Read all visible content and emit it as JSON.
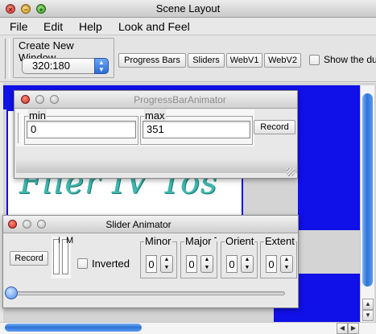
{
  "window": {
    "title": "Scene Layout"
  },
  "menu": [
    "File",
    "Edit",
    "Help",
    "Look and Feel"
  ],
  "toolbar": {
    "group_title": "Create New Window",
    "combo_value": "320:180",
    "buttons": [
      "Progress Bars",
      "Sliders",
      "WebV1",
      "WebV2"
    ],
    "show_checkbox_label": "Show the du"
  },
  "progress_frame": {
    "title": "ProgressBarAnimator",
    "min_label": "min",
    "min_value": "0",
    "max_label": "max",
    "max_value": "351",
    "record_label": "Record"
  },
  "slider_frame": {
    "title": "Slider Animator",
    "record_label": "Record",
    "slider_labels": [
      "I",
      "M"
    ],
    "inverted_label": "Inverted",
    "spinners": [
      {
        "label": "Minor",
        "value": "0"
      },
      {
        "label": "Major T",
        "value": "0"
      },
      {
        "label": "Orient",
        "value": "0"
      },
      {
        "label": "Extent",
        "value": "0"
      }
    ]
  },
  "background_text": "Flier IV Tos",
  "colors": {
    "accent_blue": "#1010e8",
    "scroll_blue": "#2e72d8",
    "close_red": "#d8372a"
  }
}
